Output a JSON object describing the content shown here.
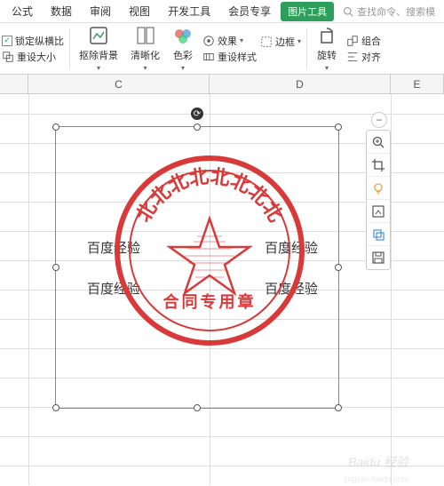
{
  "tabs": {
    "items": [
      "公式",
      "数据",
      "审阅",
      "视图",
      "开发工具",
      "会员专享"
    ],
    "active": "图片工具"
  },
  "search": {
    "placeholder": "查找命令、搜索模"
  },
  "toolbar": {
    "lock_ratio": "锁定纵横比",
    "reset_size": "重设大小",
    "remove_bg": "抠除背景",
    "clarity": "清晰化",
    "color": "色彩",
    "effect": "效果",
    "border": "边框",
    "reset_style": "重设样式",
    "rotate": "旋转",
    "group": "组合",
    "align": "对齐"
  },
  "columns": {
    "c": "C",
    "d": "D",
    "e": "E"
  },
  "cells": {
    "c1": "百度经验",
    "d1": "百度经验",
    "c2": "百度经验",
    "d2": "百度经验"
  },
  "stamp": {
    "top_text": "北北北北北北北北",
    "bottom_text": "合同专用章",
    "color": "#d83a3a"
  },
  "watermark": {
    "text": "Baidu 经验",
    "url": "jingyan.baidu.com"
  }
}
